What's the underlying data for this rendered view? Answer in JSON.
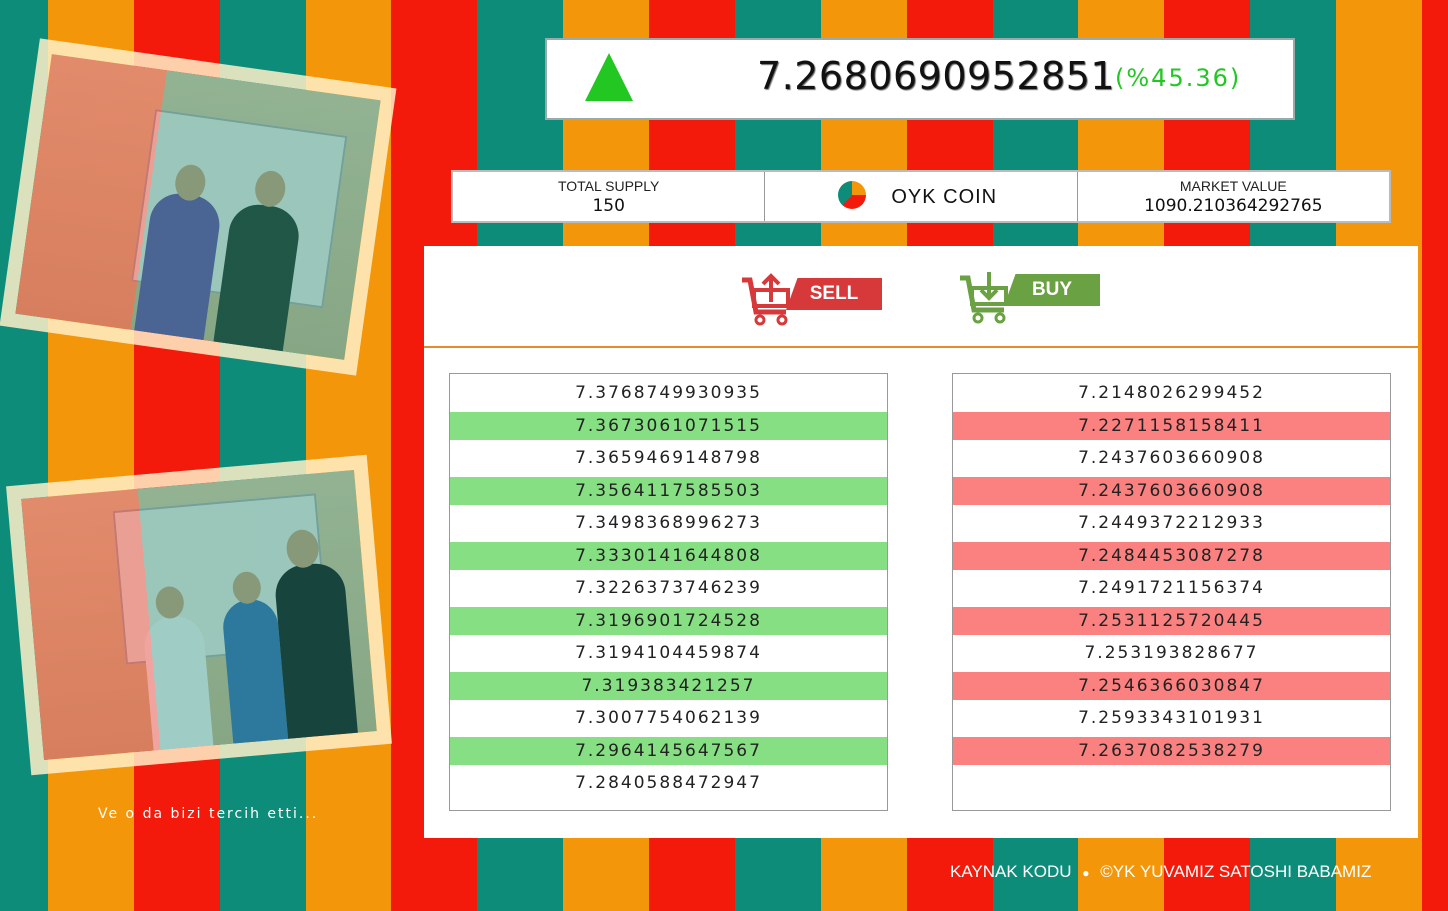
{
  "ticker": {
    "price": "7.2680690952851",
    "change": "(%45.36)",
    "direction_icon": "up-arrow-icon",
    "up_color": "#22c722"
  },
  "stats": {
    "total_supply_label": "TOTAL SUPPLY",
    "total_supply_value": "150",
    "coin_name": "OYK COIN",
    "market_value_label": "MARKET VALUE",
    "market_value": "1090.210364292765"
  },
  "actions": {
    "sell_label": "SELL",
    "buy_label": "BUY"
  },
  "sell_orders": [
    "7.3768749930935",
    "7.3673061071515",
    "7.3659469148798",
    "7.3564117585503",
    "7.3498368996273",
    "7.3330141644808",
    "7.3226373746239",
    "7.3196901724528",
    "7.3194104459874",
    "7.319383421257",
    "7.3007754062139",
    "7.2964145647567",
    "7.2840588472947"
  ],
  "buy_orders": [
    "7.2148026299452",
    "7.2271158158411",
    "7.2437603660908",
    "7.2437603660908",
    "7.2449372212933",
    "7.2484453087278",
    "7.2491721156374",
    "7.2531125720445",
    "7.253193828677",
    "7.2546366030847",
    "7.2593343101931",
    "7.2637082538279"
  ],
  "caption": "Ve o da bizi tercih etti...",
  "footer": {
    "source_link": "KAYNAK KODU",
    "separator": "●",
    "copyright": "©YK YUVAMIZ SATOSHI BABAMIZ"
  },
  "colors": {
    "teal": "#0e8c7a",
    "orange": "#f3960a",
    "red": "#f31a0b",
    "sell_row": "#86e083",
    "buy_row": "#fb8080"
  }
}
